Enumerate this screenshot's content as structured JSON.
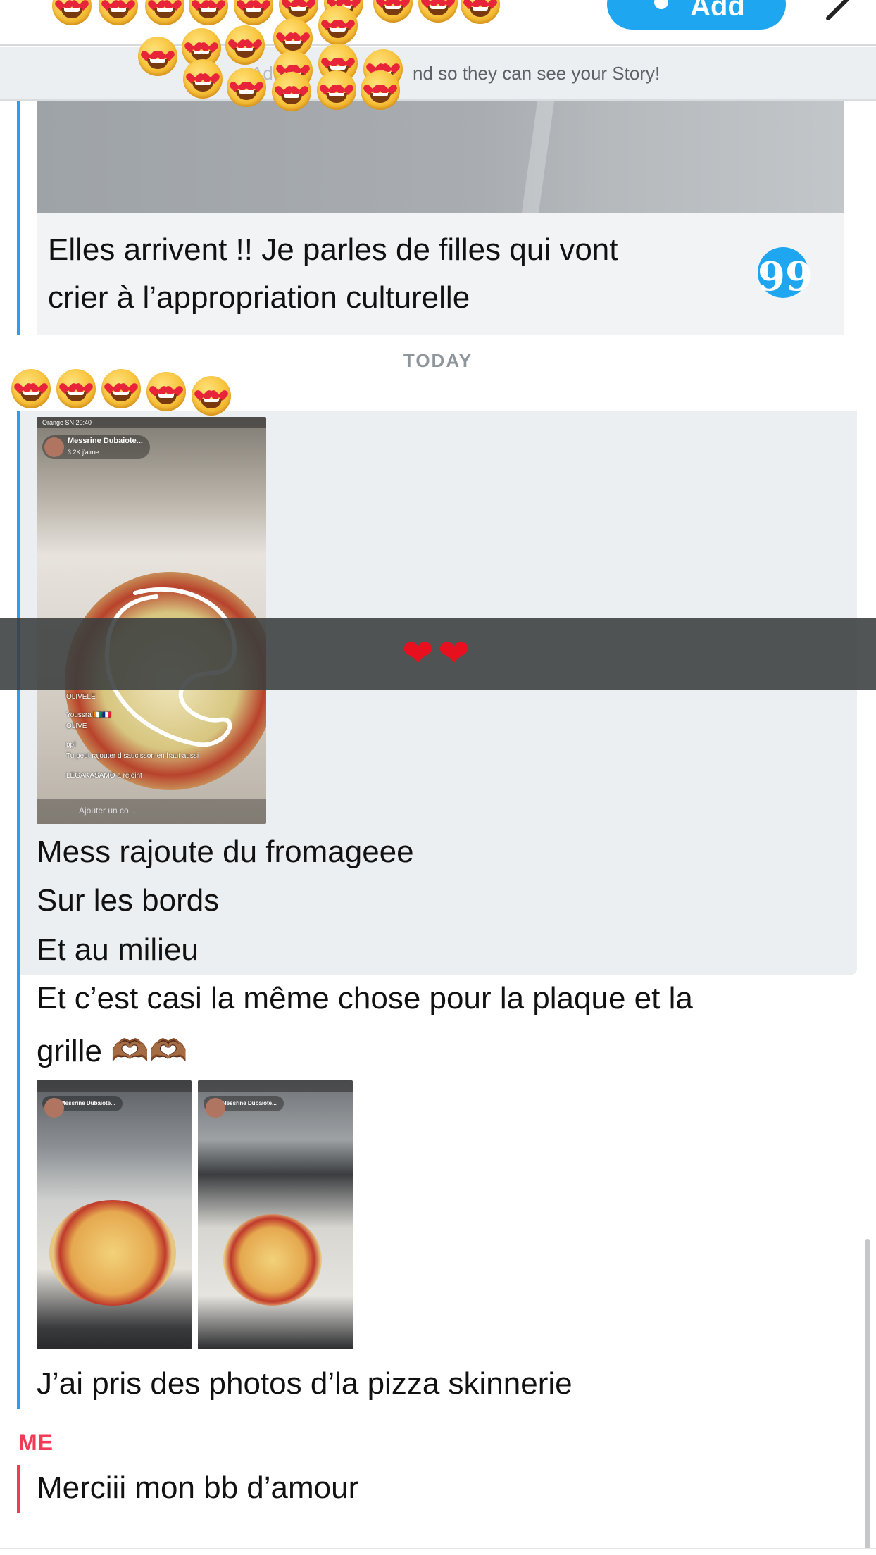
{
  "header": {
    "add_label": "Add"
  },
  "banner": {
    "visible_text": "nd so they can see your Story!",
    "hidden_text": "Add"
  },
  "quoted": {
    "text_line1": "Elles arrivent !! Je parles de filles qui vont",
    "text_line2": "crier à l’appropriation culturelle",
    "quote_glyph": "99"
  },
  "divider": {
    "label": "TODAY"
  },
  "thread": {
    "friend_messages": [
      "Mess rajoute du fromageee",
      "Sur les bords",
      "Et au milieu",
      "Et c’est casi la même chose pour la plaque et la",
      "grille 🫶🏾🫶🏾",
      "J’ai pris des photos d’la pizza skinnerie"
    ],
    "me_label": "ME",
    "me_messages": [
      "Merciii mon bb d’amour"
    ]
  },
  "snap1": {
    "status": "Orange SN  20:40",
    "profile_name": "Messrine Dubaiote...",
    "profile_likes": "3.2K j'aime",
    "comment_names": [
      "OLIVELE",
      "Youssra 🇨🇮🇫🇷",
      "OLIVE",
      "ppl"
    ],
    "comment_text": "Tu peut rajouter d saucisson en haut aussi",
    "joined_text": "LEGAKASAMO a rejoint",
    "input_placeholder": "Ajouter un co..."
  },
  "snap2": {
    "profile_name": "Messrine Dubaiote..."
  },
  "snap3": {
    "profile_name": "Messrine Dubaiote..."
  },
  "overlay": {
    "hearts": "❤❤"
  },
  "colors": {
    "friend_accent": "#2d9cf1",
    "me_accent": "#f23c57",
    "add_button": "#1ea6f0",
    "highlight_bg": "#eceff2"
  }
}
